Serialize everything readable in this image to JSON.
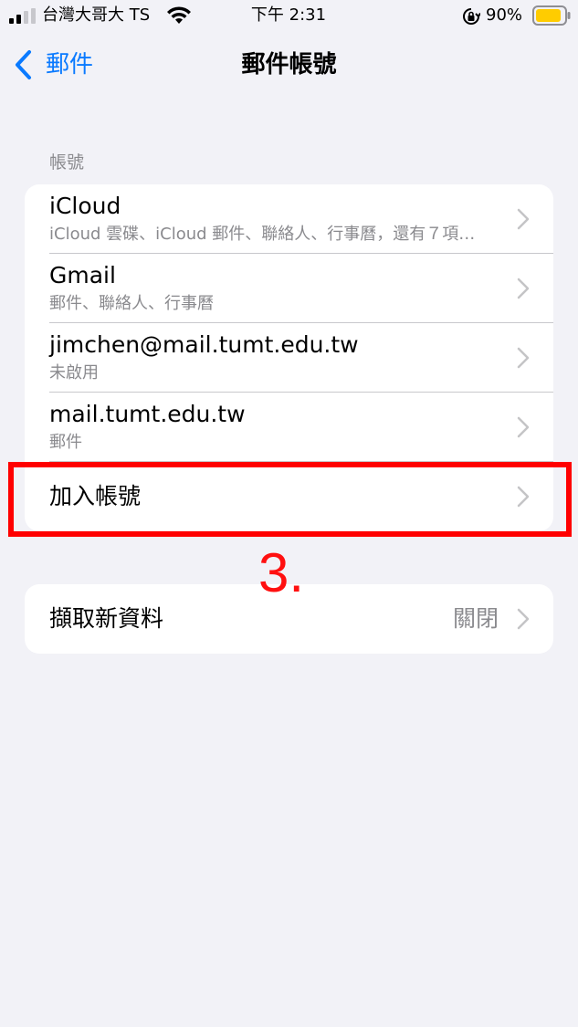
{
  "status_bar": {
    "carrier": "台灣大哥大 TS",
    "time": "下午 2:31",
    "battery_percent": "90%",
    "battery_level": 0.9,
    "battery_color": "#ffcc00",
    "signal_icon": "signal-bars-icon",
    "wifi_icon": "wifi-icon",
    "lock_icon": "orientation-lock-icon"
  },
  "nav": {
    "back_label": "郵件",
    "title": "郵件帳號",
    "accent_color": "#0a7aff"
  },
  "accounts_section": {
    "header": "帳號",
    "items": [
      {
        "title": "iCloud",
        "subtitle": "iCloud 雲碟、iCloud 郵件、聯絡人、行事曆，還有７項…"
      },
      {
        "title": "Gmail",
        "subtitle": "郵件、聯絡人、行事曆"
      },
      {
        "title": "jimchen@mail.tumt.edu.tw",
        "subtitle": "未啟用"
      },
      {
        "title": "mail.tumt.edu.tw",
        "subtitle": "郵件"
      }
    ],
    "add_account_label": "加入帳號"
  },
  "fetch_section": {
    "label": "擷取新資料",
    "value": "關閉"
  },
  "annotation": {
    "step_label": "3.",
    "color": "#ff0000"
  }
}
